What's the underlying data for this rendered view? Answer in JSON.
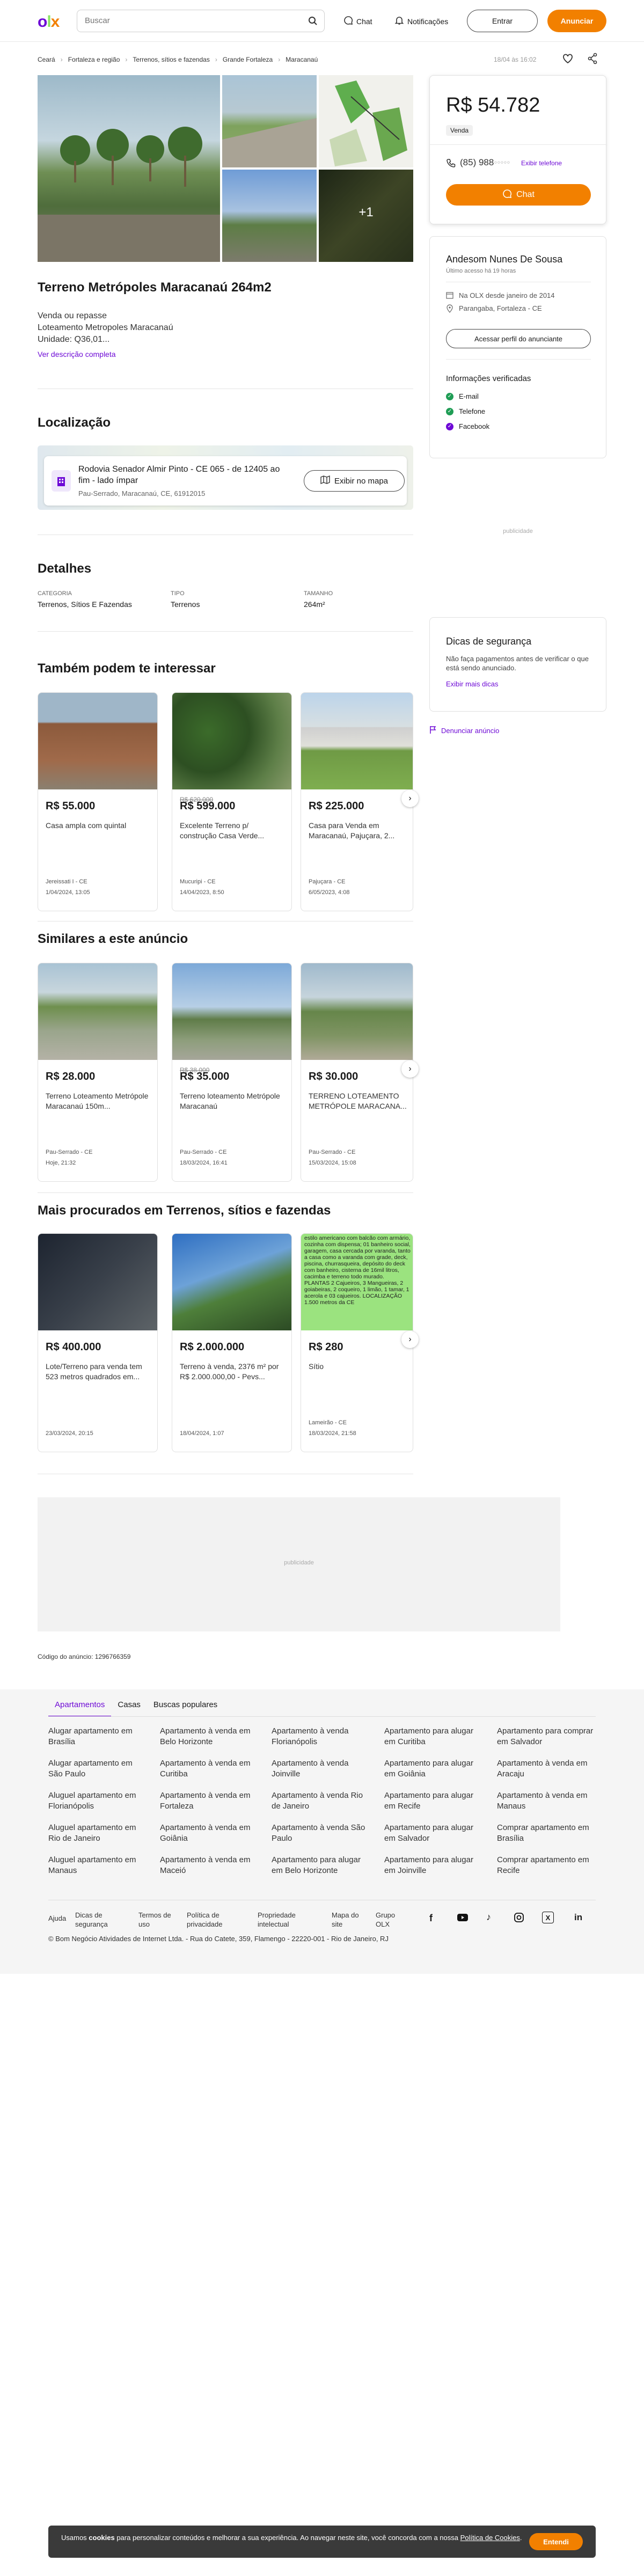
{
  "header": {
    "search_placeholder": "Buscar",
    "chat": "Chat",
    "notifications": "Notificações",
    "login": "Entrar",
    "announce": "Anunciar"
  },
  "breadcrumb": [
    "Ceará",
    "Fortaleza e região",
    "Terrenos, sítios e fazendas",
    "Grande Fortaleza",
    "Maracanaú"
  ],
  "posted": "18/04 às 16:02",
  "gallery": {
    "more_count": "+1"
  },
  "listing": {
    "title": "Terreno Metrópoles Maracanaú 264m2",
    "desc_line1": "Venda ou repasse",
    "desc_line2": "Loteamento Metropoles Maracanaú",
    "desc_line3": "Unidade: Q36,01...",
    "see_more": "Ver descrição completa"
  },
  "location": {
    "heading": "Localização",
    "street": "Rodovia Senador Almir Pinto - CE 065 - de 12405 ao fim - lado ímpar",
    "area": "Pau-Serrado, Maracanaú, CE, 61912015",
    "map_button": "Exibir no mapa"
  },
  "details": {
    "heading": "Detalhes",
    "items": [
      {
        "label": "CATEGORIA",
        "value": "Terrenos, Sítios E Fazendas"
      },
      {
        "label": "TIPO",
        "value": "Terrenos"
      },
      {
        "label": "TAMANHO",
        "value": "264m²"
      }
    ]
  },
  "sidebar": {
    "price": "R$ 54.782",
    "tag": "Venda",
    "phone": "(85) 988",
    "show_phone": "Exibir telefone",
    "chat": "Chat",
    "seller_name": "Andesom Nunes De Sousa",
    "last_access": "Último acesso há 19 horas",
    "since": "Na OLX desde janeiro de 2014",
    "seller_location": "Parangaba, Fortaleza - CE",
    "profile_button": "Acessar perfil do anunciante",
    "verified_title": "Informações verificadas",
    "verified": [
      "E-mail",
      "Telefone",
      "Facebook"
    ],
    "ad_label": "publicidade",
    "tips_title": "Dicas de segurança",
    "tips_text": "Não faça pagamentos antes de verificar o que está sendo anunciado.",
    "tips_link": "Exibir mais dicas",
    "report": "Denunciar anúncio"
  },
  "sections": [
    {
      "title": "Também podem te interessar",
      "cards": [
        {
          "price": "R$ 55.000",
          "old": "",
          "title": "Casa ampla com quintal",
          "loc": "Jereissati I - CE",
          "date": "1/04/2024, 13:05"
        },
        {
          "price": "R$ 599.000",
          "old": "R$ 620.000",
          "title": "Excelente Terreno p/ construção Casa Verde...",
          "loc": "Mucuripi - CE",
          "date": "14/04/2023, 8:50"
        },
        {
          "price": "R$ 225.000",
          "old": "",
          "title": "Casa para Venda em Maracanaú, Pajuçara, 2...",
          "loc": "Pajuçara - CE",
          "date": "6/05/2023, 4:08"
        }
      ]
    },
    {
      "title": "Similares a este anúncio",
      "cards": [
        {
          "price": "R$ 28.000",
          "old": "",
          "title": "Terreno Loteamento Metrópole Maracanaú 150m...",
          "loc": "Pau-Serrado - CE",
          "date": "Hoje, 21:32"
        },
        {
          "price": "R$ 35.000",
          "old": "R$ 38.000",
          "title": "Terreno loteamento Metrópole Maracanaú",
          "loc": "Pau-Serrado - CE",
          "date": "18/03/2024, 16:41"
        },
        {
          "price": "R$ 30.000",
          "old": "",
          "title": "TERRENO LOTEAMENTO METRÓPOLE MARACANA...",
          "loc": "Pau-Serrado - CE",
          "date": "15/03/2024, 15:08"
        }
      ]
    },
    {
      "title": "Mais procurados em Terrenos, sítios e fazendas",
      "cards": [
        {
          "price": "R$ 400.000",
          "old": "",
          "title": "Lote/Terreno para venda tem 523 metros quadrados em...",
          "loc": "",
          "date": "23/03/2024, 20:15"
        },
        {
          "price": "R$ 2.000.000",
          "old": "",
          "title": "Terreno à venda, 2376 m² por R$ 2.000.000,00 - Pevs...",
          "loc": "",
          "date": "18/04/2024, 1:07"
        },
        {
          "price": "R$ 280",
          "old": "",
          "title": "Sítio",
          "loc": "Lameirão - CE",
          "date": "18/03/2024, 21:58"
        }
      ]
    }
  ],
  "green_card_text": "estilo americano com balcão com armário, cozinha com dispensa; 01 banheiro social, garagem, casa cercada por varanda, tanto a casa como a varanda com grade, deck, piscina, churrasqueira, depósito do deck com banheiro, cisterna de 16mil litros, cacimba e terreno todo murado. PLANTAS 2 Cajueiros, 3 Mangueiras, 2 goiabeiras, 2 coqueiro, 1 limão, 1 tamar, 1 acerola e 03 cajueiros. LOCALIZAÇÃO 1.500 metros da CE",
  "ad_placeholder": "publicidade",
  "ad_code": "Código do anúncio: 1296766359",
  "footer": {
    "tabs": [
      "Apartamentos",
      "Casas",
      "Buscas populares"
    ],
    "links": [
      [
        "Alugar apartamento em Brasília",
        "Alugar apartamento em São Paulo",
        "Aluguel apartamento em Florianópolis",
        "Aluguel apartamento em Rio de Janeiro",
        "Aluguel apartamento em Manaus"
      ],
      [
        "Apartamento à venda em Belo Horizonte",
        "Apartamento à venda em Curitiba",
        "Apartamento à venda em Fortaleza",
        "Apartamento à venda em Goiânia",
        "Apartamento à venda em Maceió"
      ],
      [
        "Apartamento à venda Florianópolis",
        "Apartamento à venda Joinville",
        "Apartamento à venda Rio de Janeiro",
        "Apartamento à venda São Paulo",
        "Apartamento para alugar em Belo Horizonte"
      ],
      [
        "Apartamento para alugar em Curitiba",
        "Apartamento para alugar em Goiânia",
        "Apartamento para alugar em Recife",
        "Apartamento para alugar em Salvador",
        "Apartamento para alugar em Joinville"
      ],
      [
        "Apartamento para comprar em Salvador",
        "Apartamento à venda em Aracaju",
        "Apartamento à venda em Manaus",
        "Comprar apartamento em Brasília",
        "Comprar apartamento em Recife"
      ]
    ],
    "bottom_links": [
      "Ajuda",
      "Dicas de segurança",
      "Termos de uso",
      "Política de privacidade",
      "Propriedade intelectual",
      "Mapa do site",
      "Grupo OLX"
    ],
    "copyright": "© Bom Negócio Atividades de Internet Ltda. - Rua do Catete, 359, Flamengo - 22220-001 - Rio de Janeiro, RJ"
  },
  "cookie": {
    "text_a": "Usamos ",
    "text_bold": "cookies",
    "text_b": " para personalizar conteúdos e melhorar a sua experiência. Ao navegar neste site, você concorda com a nossa ",
    "link": "Política de Cookies",
    "text_c": ".",
    "button": "Entendi"
  },
  "colors": {
    "purple": "#6e0ad6",
    "orange": "#f28000",
    "green": "#8ce563"
  }
}
